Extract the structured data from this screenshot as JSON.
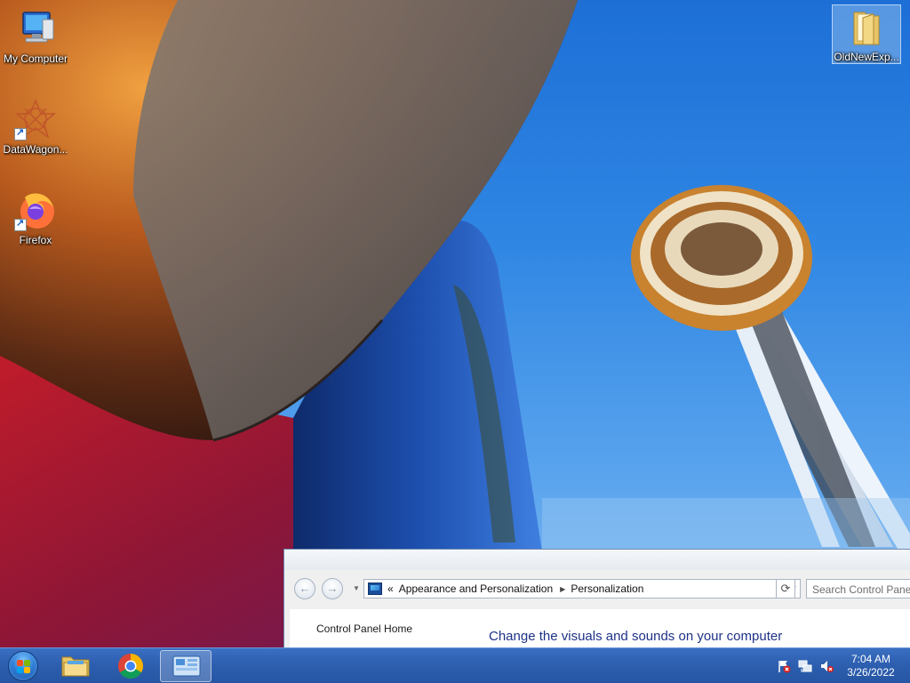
{
  "desktop": {
    "icons": [
      {
        "label": "My Computer",
        "icon": "computer-icon"
      },
      {
        "label": "DataWagon...",
        "icon": "datawagon-icon"
      },
      {
        "label": "Firefox",
        "icon": "firefox-icon"
      },
      {
        "label": "OldNewExp...",
        "icon": "folder-icon"
      }
    ]
  },
  "window": {
    "back_label": "←",
    "forward_label": "→",
    "breadcrumb_prefix": "«",
    "breadcrumb": [
      "Appearance and Personalization",
      "Personalization"
    ],
    "search_placeholder": "Search Control Panel",
    "sidebar_link": "Control Panel Home",
    "heading": "Change the visuals and sounds on your computer"
  },
  "taskbar": {
    "pinned": [
      "windows-explorer",
      "google-chrome",
      "control-panel"
    ],
    "tray_icons": [
      "action-center-flag-icon",
      "network-icon",
      "volume-muted-icon"
    ],
    "time": "7:04 AM",
    "date": "3/26/2022"
  },
  "colors": {
    "taskbar": "#2e5fb0",
    "link": "#1e3287",
    "sky": "#2f86e3"
  }
}
